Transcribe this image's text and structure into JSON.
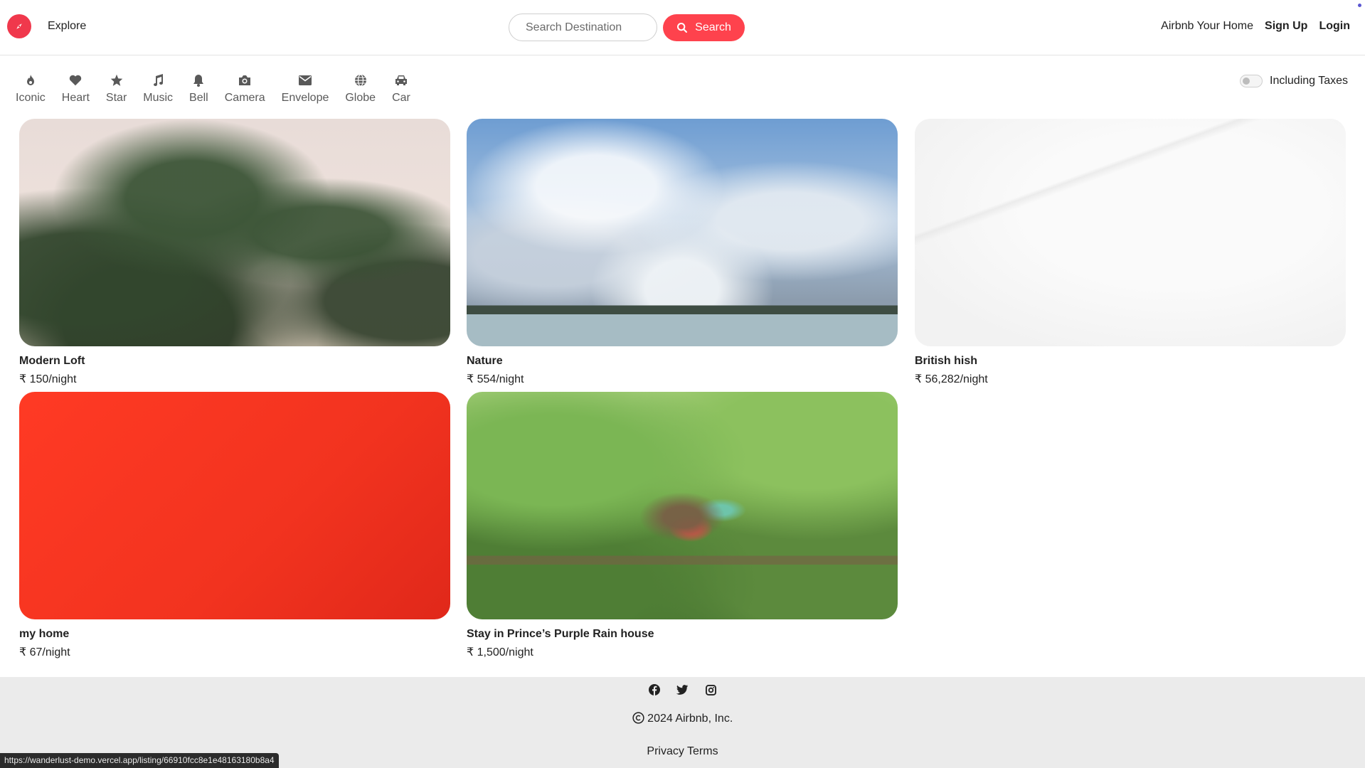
{
  "header": {
    "brand_color": "#fe424d",
    "explore_label": "Explore",
    "search_placeholder": "Search Destination",
    "search_button_label": "Search",
    "nav_links": [
      "Airbnb Your Home",
      "Sign Up",
      "Login"
    ]
  },
  "filters": [
    {
      "label": "Iconic",
      "icon": "fire-icon"
    },
    {
      "label": "Heart",
      "icon": "heart-icon"
    },
    {
      "label": "Star",
      "icon": "star-icon"
    },
    {
      "label": "Music",
      "icon": "music-icon"
    },
    {
      "label": "Bell",
      "icon": "bell-icon"
    },
    {
      "label": "Camera",
      "icon": "camera-icon"
    },
    {
      "label": "Envelope",
      "icon": "envelope-icon"
    },
    {
      "label": "Globe",
      "icon": "globe-icon"
    },
    {
      "label": "Car",
      "icon": "car-icon"
    }
  ],
  "tax_toggle": {
    "label": "Including Taxes",
    "enabled": false
  },
  "listings": [
    {
      "title": "Modern Loft",
      "price": "₹ 150/night"
    },
    {
      "title": "Nature",
      "price": "₹ 554/night"
    },
    {
      "title": "British hish",
      "price": "₹ 56,282/night"
    },
    {
      "title": "my home",
      "price": "₹ 67/night"
    },
    {
      "title": "Stay in Prince’s Purple Rain house",
      "price": "₹ 1,500/night"
    }
  ],
  "footer": {
    "social_icons": [
      "facebook-icon",
      "twitter-icon",
      "instagram-icon"
    ],
    "copyright": "2024 Airbnb, Inc.",
    "legal": "Privacy Terms"
  },
  "status_bar_url": "https://wanderlust-demo.vercel.app/listing/66910fcc8e1e48163180b8a4"
}
